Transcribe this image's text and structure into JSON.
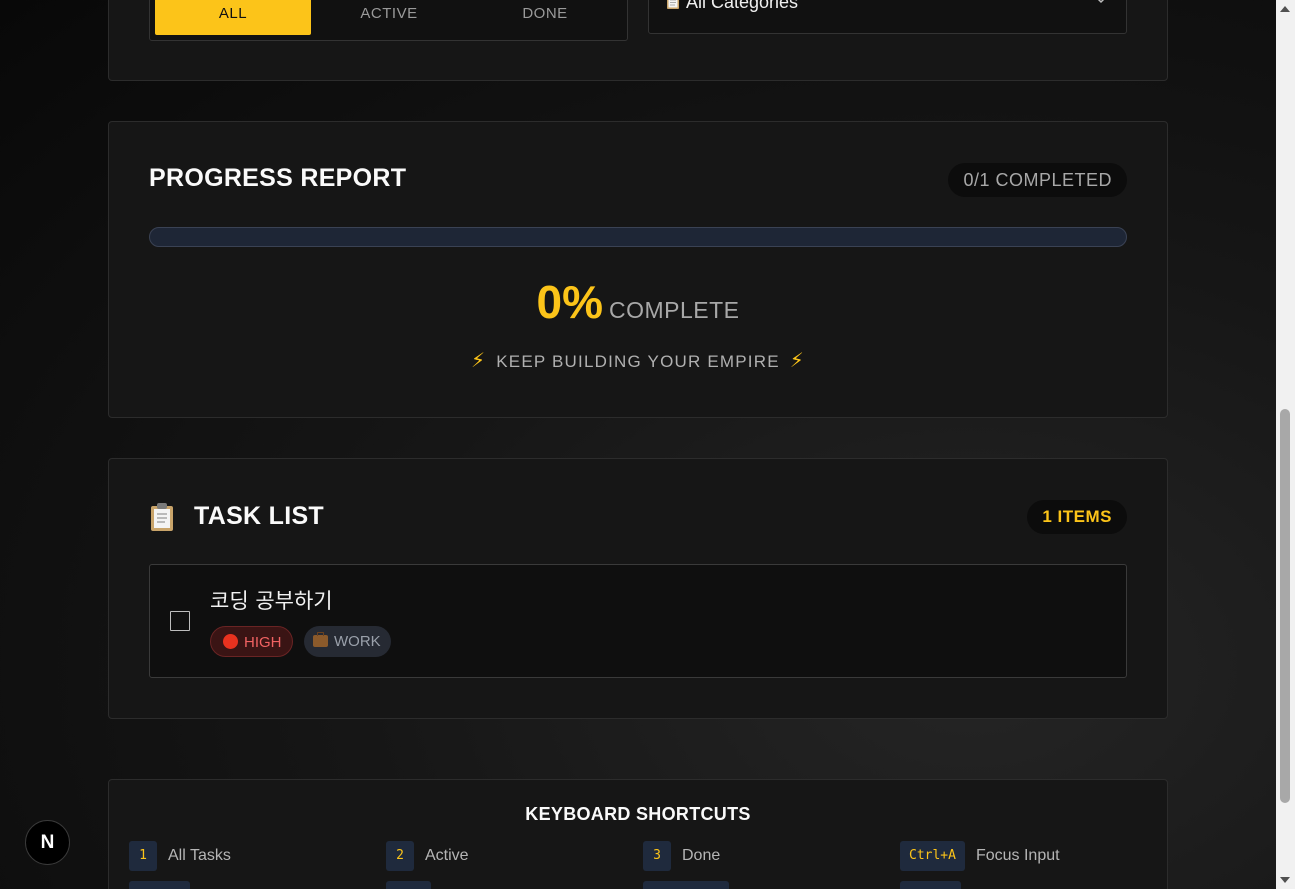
{
  "filter": {
    "tabs": [
      {
        "label": "ALL",
        "active": true
      },
      {
        "label": "ACTIVE",
        "active": false
      },
      {
        "label": "DONE",
        "active": false
      }
    ],
    "category_icon": "clipboard-icon",
    "category_value": "All Categories",
    "chevron_icon": "chevron-down-icon"
  },
  "progress": {
    "title": "PROGRESS REPORT",
    "completed_badge": "0/1 COMPLETED",
    "completed": 0,
    "total": 1,
    "percent_value": "0%",
    "percent_fraction": 0,
    "percent_label": "COMPLETE",
    "motto": "KEEP BUILDING YOUR EMPIRE",
    "motto_icon": "⚡"
  },
  "tasks": {
    "title": "TASK LIST",
    "title_icon": "clipboard-icon",
    "count_badge": "1 ITEMS",
    "items": [
      {
        "title": "코딩 공부하기",
        "checked": false,
        "priority": "HIGH",
        "priority_icon": "red-circle-icon",
        "category": "WORK",
        "category_icon": "briefcase-icon"
      }
    ]
  },
  "shortcuts": {
    "title": "KEYBOARD SHORTCUTS",
    "items": [
      {
        "key": "1",
        "label": "All Tasks"
      },
      {
        "key": "2",
        "label": "Active"
      },
      {
        "key": "3",
        "label": "Done"
      },
      {
        "key": "Ctrl+A",
        "label": "Focus Input"
      }
    ]
  },
  "floating_badge": "N",
  "colors": {
    "accent": "#fcc419",
    "card_bg": "#161616",
    "high_priority": "#f06262",
    "progress_track": "#1e2636"
  }
}
